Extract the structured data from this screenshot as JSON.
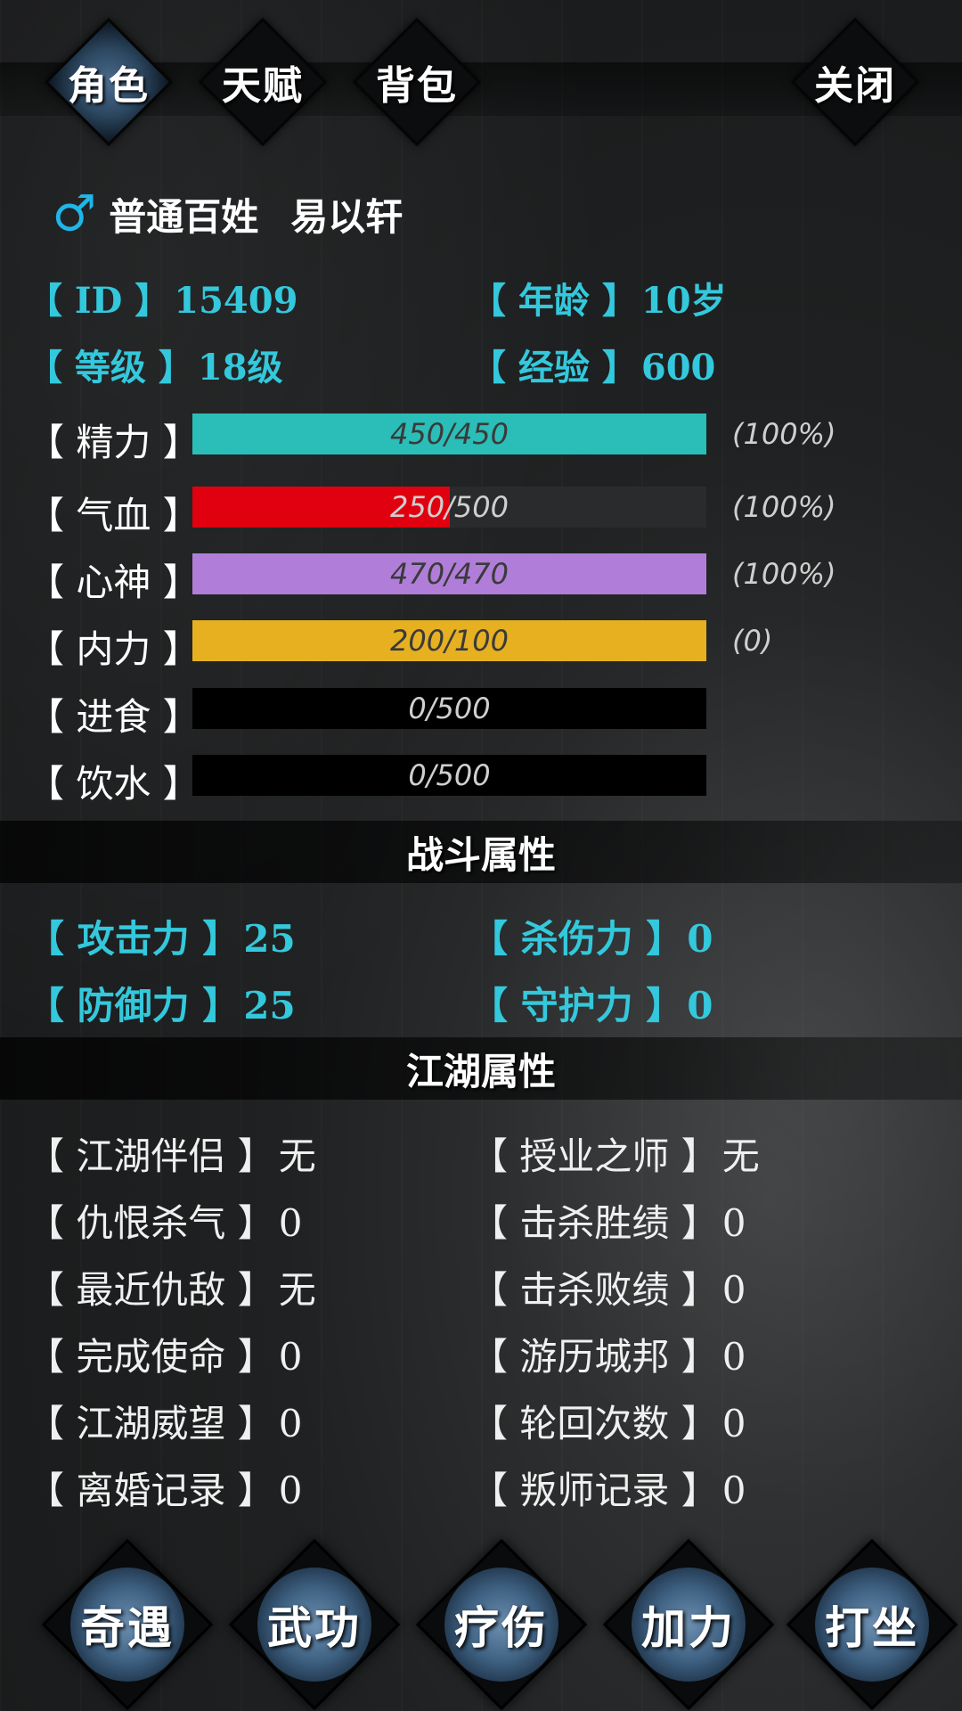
{
  "tabs": [
    {
      "label": "角色",
      "active": true
    },
    {
      "label": "天赋",
      "active": false
    },
    {
      "label": "背包",
      "active": false
    }
  ],
  "close_label": "关闭",
  "player": {
    "gender_icon": "♂",
    "rank": "普通百姓",
    "name": "易以轩"
  },
  "info": {
    "id_label": "【 ID 】",
    "id_value": "15409",
    "age_label": "【 年龄 】",
    "age_value": "10岁",
    "level_label": "【 等级 】",
    "level_value": "18级",
    "exp_label": "【 经验 】",
    "exp_value": "600"
  },
  "stats": [
    {
      "label": "【 精力 】",
      "text": "450/450",
      "fill_fraction": 1.0,
      "color": "#2bbdb8",
      "pct": "(100%)"
    },
    {
      "label": "【 气血 】",
      "text": "250/500",
      "fill_fraction": 0.5,
      "color": "#e0000f",
      "pct": "(100%)"
    },
    {
      "label": "【 心神 】",
      "text": "470/470",
      "fill_fraction": 1.0,
      "color": "#b07ed8",
      "pct": "(100%)"
    },
    {
      "label": "【 内力 】",
      "text": "200/100",
      "fill_fraction": 1.0,
      "color": "#e6b021",
      "pct": "(0)"
    },
    {
      "label": "【 进食 】",
      "text": "0/500",
      "fill_fraction": 0.0,
      "color": "#000000",
      "pct": ""
    },
    {
      "label": "【 饮水 】",
      "text": "0/500",
      "fill_fraction": 0.0,
      "color": "#000000",
      "pct": ""
    }
  ],
  "combat": {
    "title": "战斗属性",
    "attack_label": "【 攻击力 】",
    "attack_value": "25",
    "kill_label": "【 杀伤力 】",
    "kill_value": "0",
    "defense_label": "【 防御力 】",
    "defense_value": "25",
    "guard_label": "【 守护力 】",
    "guard_value": "0"
  },
  "jianghu": {
    "title": "江湖属性",
    "items": [
      {
        "label": "【 江湖伴侣 】",
        "value": "无"
      },
      {
        "label": "【 授业之师 】",
        "value": "无"
      },
      {
        "label": "【 仇恨杀气 】",
        "value": "0"
      },
      {
        "label": "【 击杀胜绩 】",
        "value": "0"
      },
      {
        "label": "【 最近仇敌 】",
        "value": "无"
      },
      {
        "label": "【 击杀败绩 】",
        "value": "0"
      },
      {
        "label": "【 完成使命 】",
        "value": "0"
      },
      {
        "label": "【 游历城邦 】",
        "value": "0"
      },
      {
        "label": "【 江湖威望 】",
        "value": "0"
      },
      {
        "label": "【 轮回次数 】",
        "value": "0"
      },
      {
        "label": "【 离婚记录 】",
        "value": "0"
      },
      {
        "label": "【 叛师记录 】",
        "value": "0"
      }
    ]
  },
  "bottom_buttons": [
    "奇遇",
    "武功",
    "疗伤",
    "加力",
    "打坐"
  ]
}
